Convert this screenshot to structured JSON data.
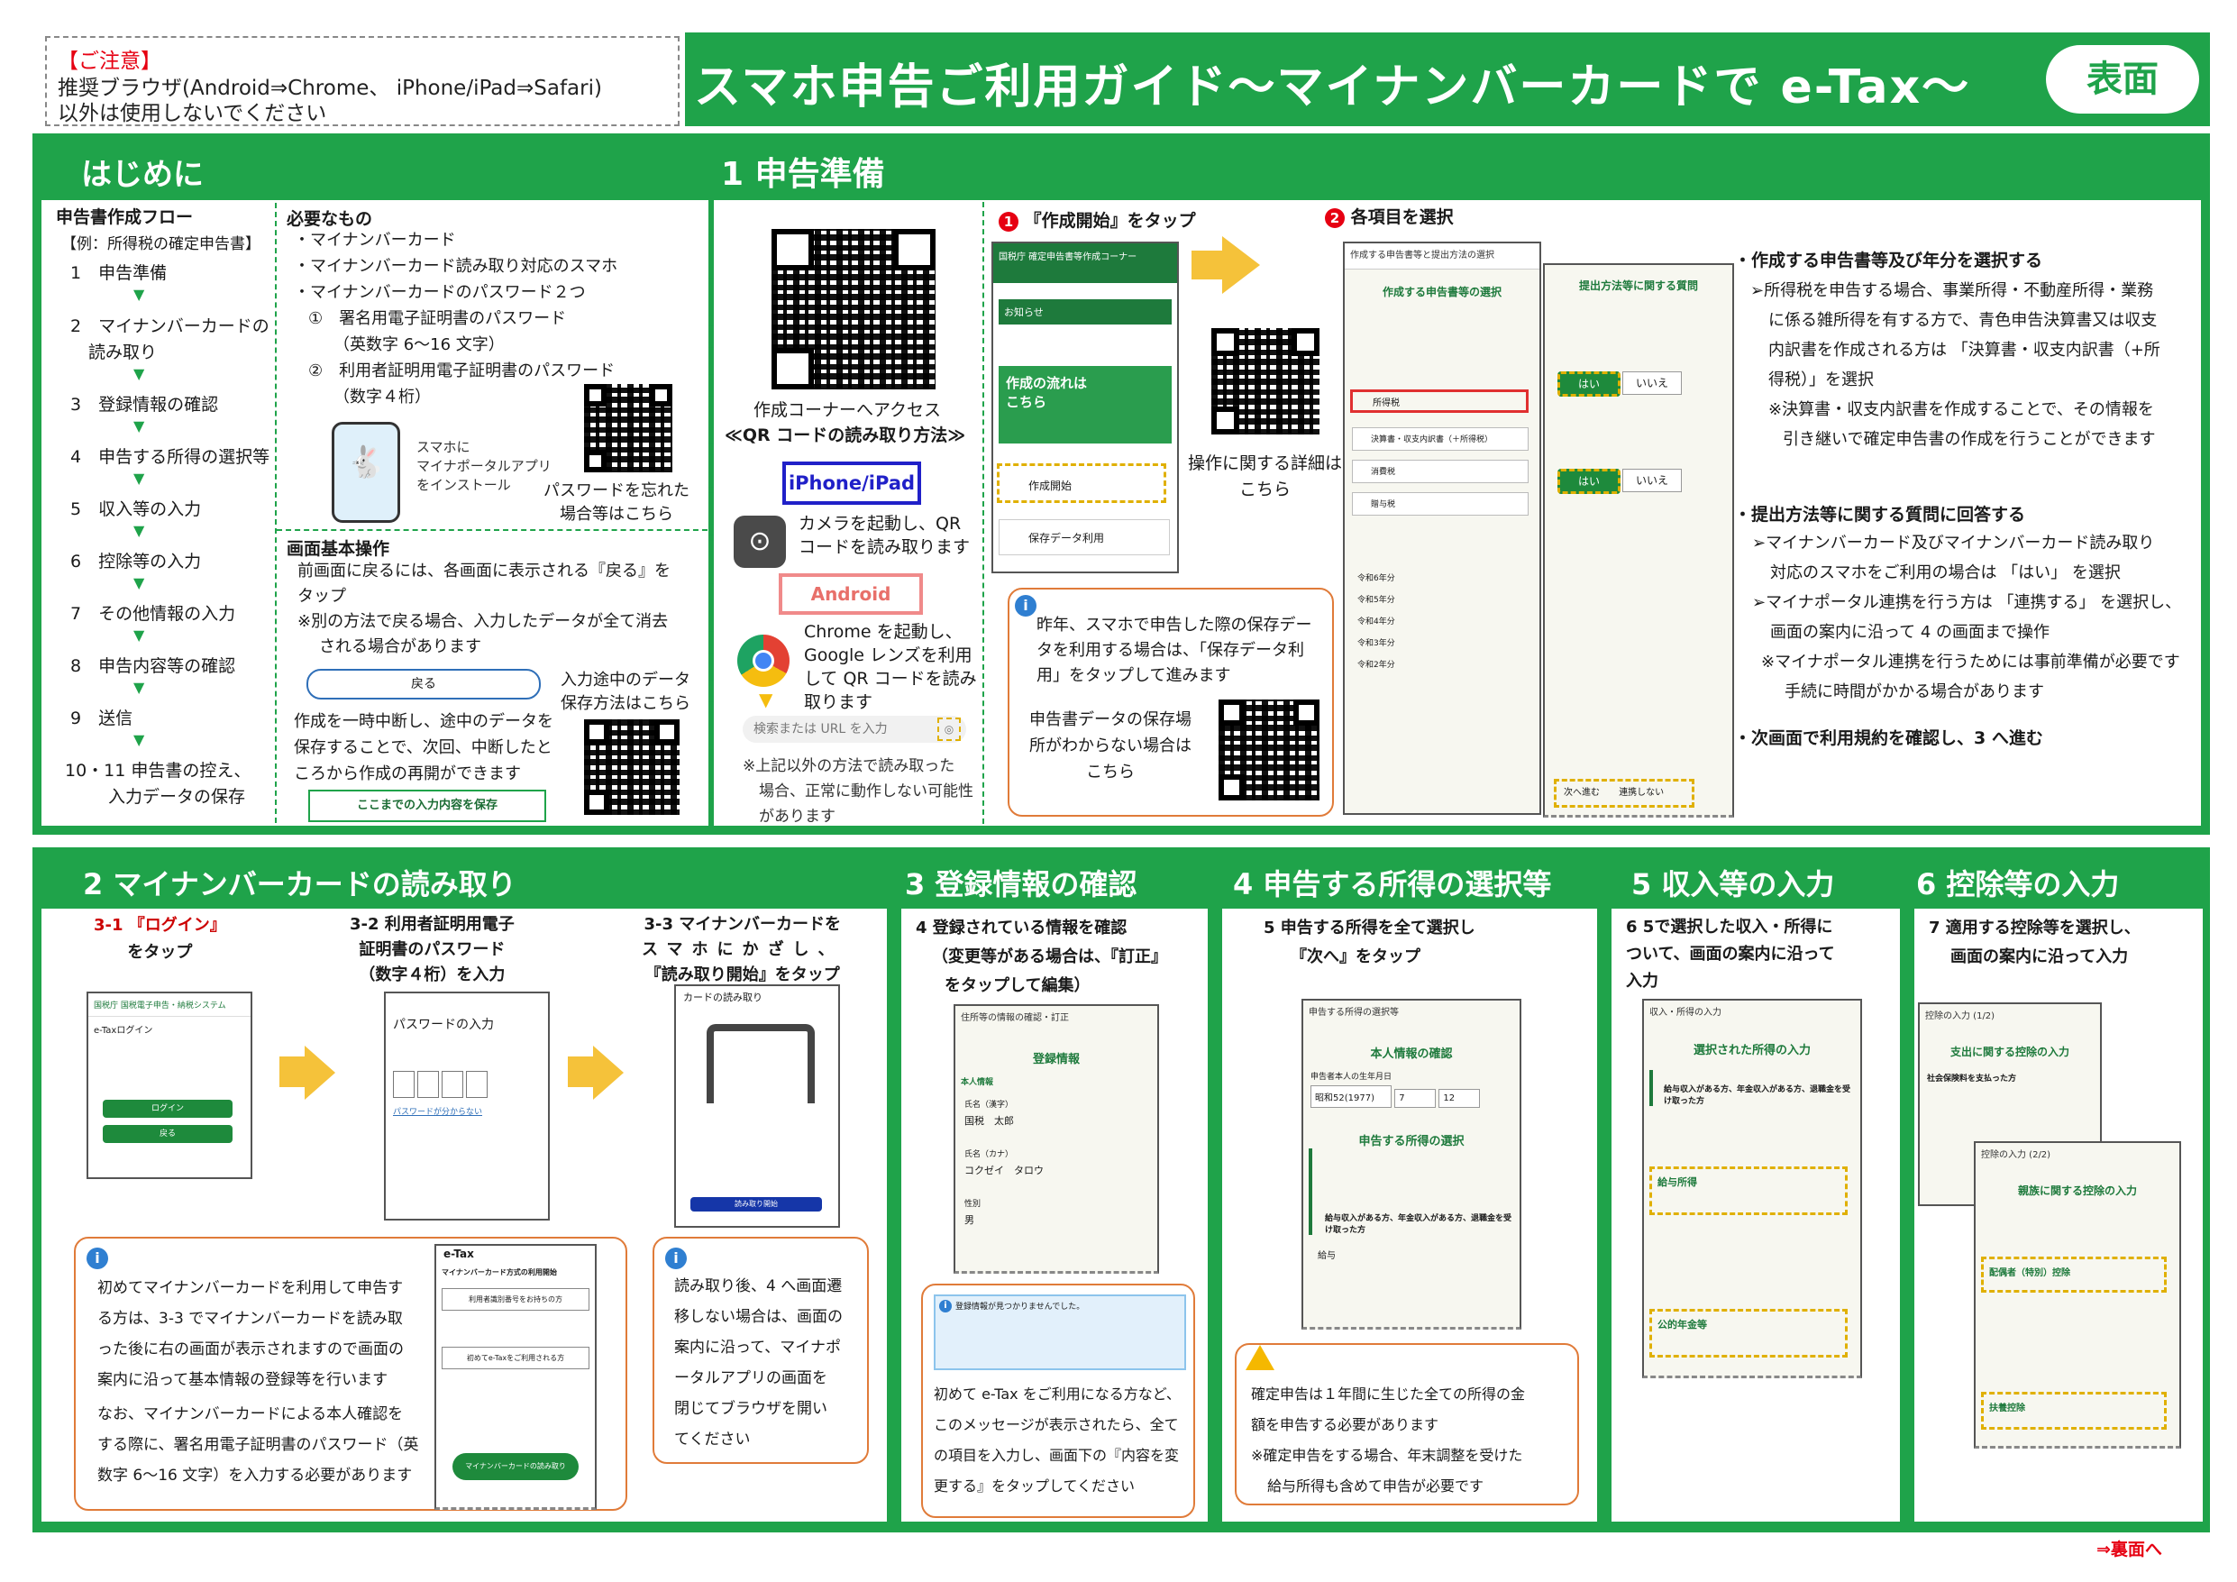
{
  "notice": {
    "title": "【ご注意】",
    "line1": "推奨ブラウザ(Android⇒Chrome、 iPhone/iPad⇒Safari)",
    "line2": "以外は使用しないでください"
  },
  "banner": {
    "title": "スマホ申告ご利用ガイド～マイナンバーカードで e-Tax～",
    "side_label": "表面"
  },
  "section_intro": {
    "title": "はじめに",
    "flow_title": "申告書作成フロー",
    "flow_example": "【例：所得税の確定申告書】",
    "flow_steps": [
      "1　申告準備",
      "2　マイナンバーカードの",
      "読み取り",
      "3　登録情報の確認",
      "4　申告する所得の選択等",
      "5　収入等の入力",
      "6　控除等の入力",
      "7　その他情報の入力",
      "8　申告内容等の確認",
      "9　送信",
      "10・11 申告書の控え、",
      "入力データの保存"
    ],
    "needs_title": "必要なもの",
    "needs": [
      "・マイナンバーカード",
      "・マイナンバーカード読み取り対応のスマホ",
      "・マイナンバーカードのパスワード２つ",
      "①　署名用電子証明書のパスワード",
      "（英数字 6～16 文字）",
      "②　利用者証明用電子証明書のパスワード",
      "（数字４桁）"
    ],
    "app_note": [
      "スマホに",
      "マイナポータルアプリ",
      "をインストール"
    ],
    "forgot_pw": [
      "パスワードを忘れた",
      "場合等はこちら"
    ],
    "basic_title": "画面基本操作",
    "basic_lines": [
      "前画面に戻るには、各画面に表示される『戻る』を",
      "タップ",
      "※別の方法で戻る場合、入力したデータが全て消去",
      "される場合があります"
    ],
    "back_btn": "戻る",
    "save_note": [
      "入力途中のデータ",
      "保存方法はこちら"
    ],
    "pause_lines": [
      "作成を一時中断し、途中のデータを",
      "保存することで、次回、中断したと",
      "ころから作成の再開ができます"
    ],
    "save_btn": "ここまでの入力内容を保存"
  },
  "section1": {
    "title": "1  申告準備",
    "qr_caption1": "作成コーナーへアクセス",
    "qr_caption2": "≪QR コードの読み取り方法≫",
    "iphone_label": "iPhone/iPad",
    "iphone_text": [
      "カメラを起動し、QR",
      "コードを読み取ります"
    ],
    "android_label": "Android",
    "android_text": [
      "Chrome を起動し、",
      "Google レンズを利用",
      "して QR コードを読み",
      "取ります"
    ],
    "search_placeholder": "検索または URL を入力",
    "other_note": [
      "※上記以外の方法で読み取った",
      "場合、正常に動作しない可能性",
      "があります"
    ],
    "step1_label": "『作成開始』をタップ",
    "step1_num": "1",
    "phone1_header": "国税庁 確定申告書等作成コーナー",
    "phone1_notice": "お知らせ",
    "phone1_flow": [
      "作成の流れは",
      "こちら"
    ],
    "phone1_start": "作成開始",
    "phone1_saved": "保存データ利用",
    "op_detail": [
      "操作に関する詳細は",
      "こちら"
    ],
    "step2_num": "2",
    "step2_label": "各項目を選択",
    "phone2_title": "作成する申告書等と提出方法の選択",
    "phone2_sub": "作成する申告書等の選択",
    "phone2_options": [
      "所得税",
      "決算書・収支内訳書（＋所得税）",
      "消費税",
      "贈与税"
    ],
    "phone2_years": [
      "令和6年分",
      "令和5年分",
      "令和4年分",
      "令和3年分",
      "令和2年分"
    ],
    "phone3_title": "提出方法等に関する質問",
    "phone3_yes": "はい",
    "phone3_no": "いいえ",
    "phone3_next": "次へ進む",
    "phone3_cancel": "連携しない",
    "resume_lines": [
      "昨年、スマホで申告した際の保存デー",
      "タを利用する場合は、「保存データ利",
      "用」をタップして進みます"
    ],
    "saved_loc": [
      "申告書データの保存場",
      "所がわからない場合は",
      "こちら"
    ],
    "right_h1": "・作成する申告書等及び年分を選択する",
    "right_p1": [
      "➢所得税を申告する場合、事業所得・不動産所得・業務",
      "に係る雑所得を有する方で、青色申告決算書又は収支",
      "内訳書を作成される方は 「決算書・収支内訳書（+所",
      "得税）」を選択",
      "※決算書・収支内訳書を作成することで、その情報を",
      "引き継いで確定申告書の作成を行うことができます"
    ],
    "right_h2": "・提出方法等に関する質問に回答する",
    "right_p2": [
      "➢マイナンバーカード及びマイナンバーカード読み取り",
      "対応のスマホをご利用の場合は 「はい」 を選択",
      "➢マイナポータル連携を行う方は 「連携する」 を選択し、",
      "画面の案内に沿って 4 の画面まで操作",
      "※マイナポータル連携を行うためには事前準備が必要です",
      "手続に時間がかかる場合があります"
    ],
    "right_h3": "・次画面で利用規約を確認し、3 へ進む"
  },
  "section2": {
    "title": "2  マイナンバーカードの読み取り",
    "s31": [
      "3-1 『ログイン』",
      "をタップ"
    ],
    "s32": [
      "3-2 利用者証明用電子",
      "証明書のパスワード",
      "（数字４桁）を入力"
    ],
    "s33": [
      "3-3 マイナンバーカードを",
      "スマホにかざし、",
      "『読み取り開始』をタップ"
    ],
    "login_header": "国税庁 国税電子申告・納税システム",
    "login_title": "e-Taxログイン",
    "login_btn": "ログイン",
    "back_btn": "戻る",
    "pw_title": "パスワードの入力",
    "pw_link": "パスワードが分からない",
    "read_title": "カードの読み取り",
    "read_btn": "読み取り開始",
    "info_lines": [
      "初めてマイナンバーカードを利用して申告す",
      "る方は、3-3 でマイナンバーカードを読み取",
      "った後に右の画面が表示されますので画面の",
      "案内に沿って基本情報の登録等を行います",
      "なお、マイナンバーカードによる本人確認を",
      "する際に、署名用電子証明書のパスワード（英",
      "数字 6～16 文字）を入力する必要があります"
    ],
    "etax_head": "e-Tax",
    "etax_lines": [
      "マイナンバーカード方式の利用開始",
      "利用者識別番号をお持ちの方",
      "初めてe-Taxをご利用される方",
      "マイナンバーカードの読み取り"
    ],
    "after_lines": [
      "読み取り後、4 へ画面遷",
      "移しない場合は、画面の",
      "案内に沿って、マイナポ",
      "ータルアプリの画面を",
      "閉じてブラウザを開い",
      "てください"
    ]
  },
  "section3": {
    "title": "3  登録情報の確認",
    "step": [
      "4 登録されている情報を確認",
      "（変更等がある場合は、『訂正』",
      "をタップして編集）"
    ],
    "phone_title": "住所等の情報の確認・訂正",
    "phone_h": "登録情報",
    "phone_sub": "本人情報",
    "name_label": "氏名（漢字）",
    "name_val": "国税　太郎",
    "kana_label": "氏名（カナ）",
    "kana_val": "コクゼイ　タロウ",
    "sex_label": "性別",
    "sex_val": "男",
    "warn": "登録情報が見つかりませんでした。",
    "note": [
      "初めて e-Tax をご利用になる方など、",
      "このメッセージが表示されたら、全て",
      "の項目を入力し、画面下の『内容を変",
      "更する』をタップしてください"
    ]
  },
  "section4": {
    "title": "4  申告する所得の選択等",
    "step": [
      "5 申告する所得を全て選択し",
      "『次へ』をタップ"
    ],
    "phone_title": "申告する所得の選択等",
    "phone_h1": "本人情報の確認",
    "birth_label": "申告者本人の生年月日",
    "birth_era": "昭和52(1977)",
    "birth_m": "7",
    "birth_d": "12",
    "phone_h2": "申告する所得の選択",
    "salary": "給与収入がある方、年金収入がある方、退職金を受け取った方",
    "salary_item": "給与",
    "warn_lines": [
      "確定申告は１年間に生じた全ての所得の金",
      "額を申告する必要があります",
      "※確定申告をする場合、年末調整を受けた",
      "給与所得も含めて申告が必要です"
    ]
  },
  "section5": {
    "title": "5  収入等の入力",
    "step": [
      "6 5で選択した収入・所得に",
      "ついて、画面の案内に沿って",
      "入力"
    ],
    "phone_title": "収入・所得の入力",
    "phone_h": "選択された所得の入力",
    "salary_h": "給与収入がある方、年金収入がある方、退職金を受け取った方",
    "salary_item": "給与所得",
    "pension_item": "公的年金等"
  },
  "section6": {
    "title": "6  控除等の入力",
    "step": [
      "7 適用する控除等を選択し、",
      "画面の案内に沿って入力"
    ],
    "phone_title": "控除の入力 (1/2)",
    "phone_h": "支出に関する控除の入力",
    "social": "社会保険料を支払った方",
    "phone2_title": "控除の入力 (2/2)",
    "phone2_h": "親族に関する控除の入力",
    "spouse": "配偶者（特別）控除",
    "dependent": "扶養控除"
  },
  "footer": {
    "next": "⇒裏面へ"
  }
}
